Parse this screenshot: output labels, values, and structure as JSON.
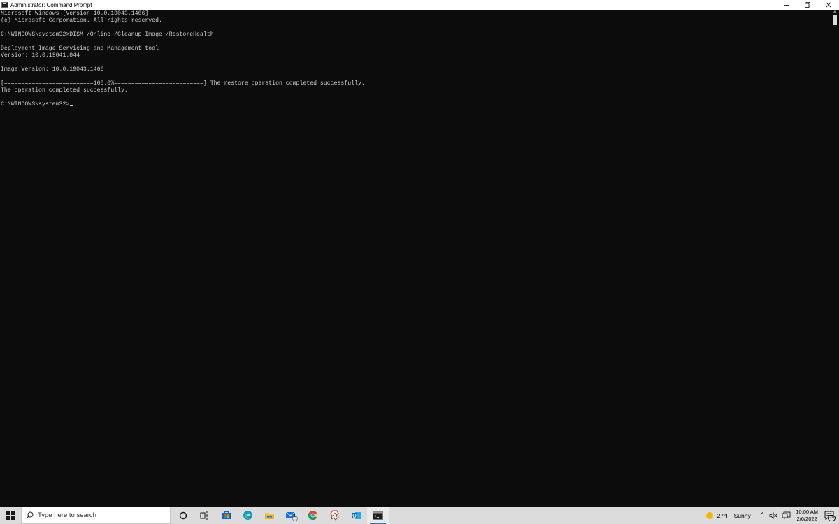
{
  "window": {
    "title": "Administrator: Command Prompt"
  },
  "console": {
    "lines": [
      "Microsoft Windows [Version 10.0.19043.1466]",
      "(c) Microsoft Corporation. All rights reserved.",
      "",
      "C:\\WINDOWS\\system32>DISM /Online /Cleanup-Image /RestoreHealth",
      "",
      "Deployment Image Servicing and Management tool",
      "Version: 10.0.19041.844",
      "",
      "Image Version: 10.0.19043.1466",
      "",
      "[==========================100.0%==========================] The restore operation completed successfully.",
      "The operation completed successfully.",
      ""
    ],
    "prompt": "C:\\WINDOWS\\system32>"
  },
  "taskbar": {
    "search_placeholder": "Type here to search",
    "apps": [
      "cortana-icon",
      "task-view-icon",
      "store-icon",
      "edge-icon",
      "file-explorer-icon",
      "mail-icon",
      "chrome-icon",
      "paint-icon",
      "outlook-icon",
      "command-prompt-icon"
    ],
    "mail_badge": "1",
    "weather_temp": "27°F",
    "weather_text": "Sunny",
    "time": "10:00 AM",
    "date": "2/6/2022",
    "notification_count": "20"
  },
  "colors": {
    "console_bg": "#0c0c0c",
    "console_fg": "#cccccc",
    "taskbar_bg": "#dcdcdc",
    "accent": "#3a6fb5"
  }
}
